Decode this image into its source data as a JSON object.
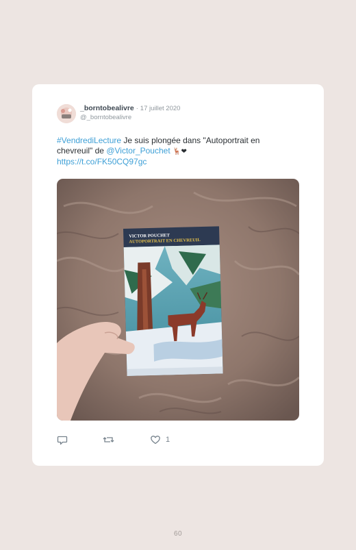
{
  "tweet": {
    "username": "_borntobealivre",
    "separator": "·",
    "date": "17 juillet 2020",
    "handle": "@_borntobealivre",
    "hashtag": "#VendrediLecture",
    "text_part1": " Je suis plongée dans \"Autoportrait en chevreuil\" de ",
    "mention": "@Victor_Pouchet",
    "emojis": "🦌❤",
    "url": "https://t.co/FK50CQ97gc"
  },
  "book": {
    "author": "VICTOR POUCHET",
    "title": "AUTOPORTRAIT EN CHEVREUIL"
  },
  "actions": {
    "reply_icon": "reply-icon",
    "retweet_icon": "retweet-icon",
    "like_icon": "heart-icon",
    "like_count": "1"
  },
  "page_number": "60",
  "colors": {
    "background": "#ede5e2",
    "card": "#ffffff",
    "link": "#3d9fd6",
    "icon": "#76828c"
  }
}
